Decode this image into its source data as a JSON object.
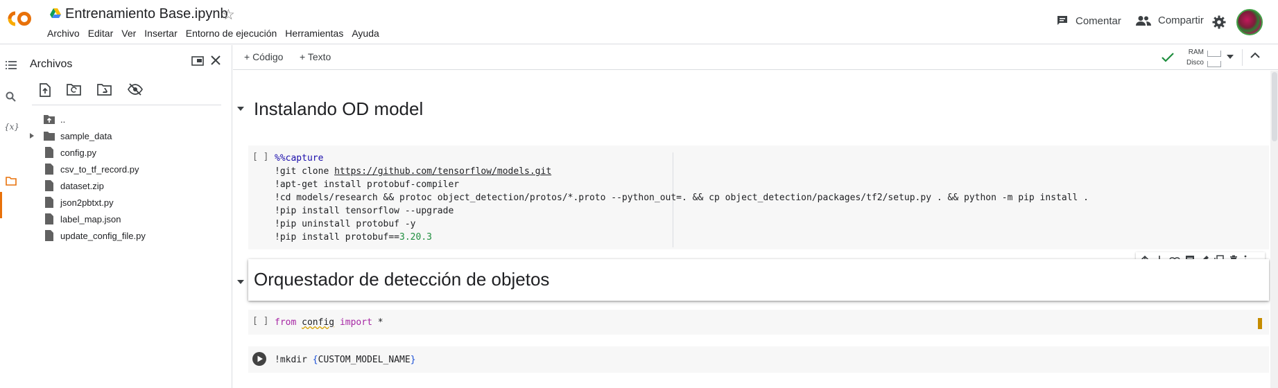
{
  "header": {
    "logo": "colab-logo-icon",
    "title": "Entrenamiento Base.ipynb",
    "menu": [
      "Archivo",
      "Editar",
      "Ver",
      "Insertar",
      "Entorno de ejecución",
      "Herramientas",
      "Ayuda"
    ],
    "comment_label": "Comentar",
    "share_label": "Compartir"
  },
  "sidebar": {
    "title": "Archivos",
    "tree": [
      {
        "name": "..",
        "kind": "parent"
      },
      {
        "name": "sample_data",
        "kind": "folder"
      },
      {
        "name": "config.py",
        "kind": "file"
      },
      {
        "name": "csv_to_tf_record.py",
        "kind": "file"
      },
      {
        "name": "dataset.zip",
        "kind": "file"
      },
      {
        "name": "json2pbtxt.py",
        "kind": "file"
      },
      {
        "name": "label_map.json",
        "kind": "file"
      },
      {
        "name": "update_config_file.py",
        "kind": "file"
      }
    ]
  },
  "toolbar": {
    "add_code": "+ Código",
    "add_text": "+ Texto",
    "ram_label": "RAM",
    "disk_label": "Disco"
  },
  "notebook": {
    "heading1": "Instalando OD model",
    "cell1": {
      "exec": "[ ]",
      "lines": [
        "%%capture",
        "!git clone https://github.com/tensorflow/models.git",
        "!apt-get install protobuf-compiler",
        "!cd models/research && protoc object_detection/protos/*.proto --python_out=. && cp object_detection/packages/tf2/setup.py . && python -m pip install .",
        "!pip install tensorflow --upgrade",
        "!pip uninstall protobuf -y",
        "!pip install protobuf==3.20.3"
      ],
      "git_cmd": "!git clone ",
      "git_url": "https://github.com/tensorflow/models.git",
      "pb_cmd": "!pip install protobuf==",
      "pb_ver": "3.20.3"
    },
    "heading2": "Orquestador de detección de objetos",
    "cell3": {
      "exec": "[ ]",
      "from": "from",
      "module": "config",
      "import": "import",
      "star": " *"
    },
    "cell4": {
      "cmd": "!mkdir ",
      "open_brace": "{",
      "var": "CUSTOM_MODEL_NAME",
      "close_brace": "}"
    }
  },
  "colors": {
    "accent": "#e8710a",
    "check": "#1e8e3e",
    "warning": "#c58c00"
  }
}
